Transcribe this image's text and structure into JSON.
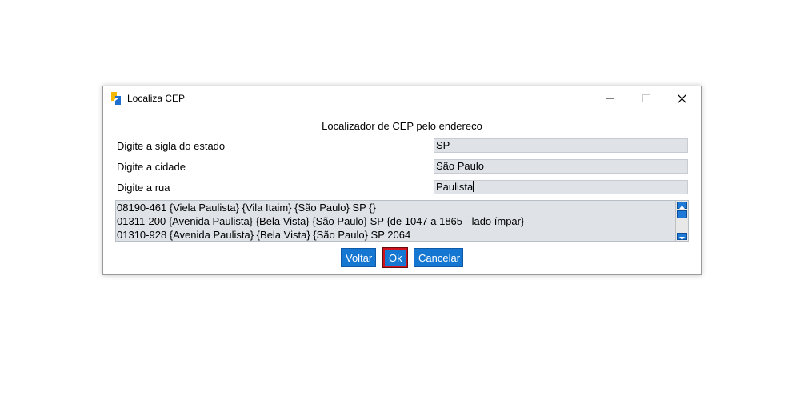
{
  "window": {
    "title": "Localiza CEP",
    "app_icon": "localiza-cep-app-icon",
    "controls": {
      "minimize_icon": "minimize-icon",
      "maximize_icon": "maximize-icon",
      "close_icon": "close-icon"
    }
  },
  "form": {
    "heading": "Localizador de CEP pelo endereco",
    "state_label": "Digite a sigla do estado",
    "state_value": "SP",
    "city_label": "Digite a cidade",
    "city_value": "São Paulo",
    "street_label": "Digite a rua",
    "street_value": "Paulista"
  },
  "results": [
    "08190-461 {Viela Paulista} {Vila Itaim} {São Paulo} SP {}",
    "01311-200 {Avenida Paulista} {Bela Vista} {São Paulo} SP {de 1047 a 1865 - lado ímpar}",
    "01310-928 {Avenida Paulista} {Bela Vista} {São Paulo} SP 2064"
  ],
  "buttons": {
    "back_label": "Voltar",
    "ok_label": "Ok",
    "cancel_label": "Cancelar"
  },
  "colors": {
    "button_bg": "#1677d2",
    "button_text": "#ffffff",
    "input_bg": "#dfe3e8",
    "focus_border": "#d0141e"
  }
}
